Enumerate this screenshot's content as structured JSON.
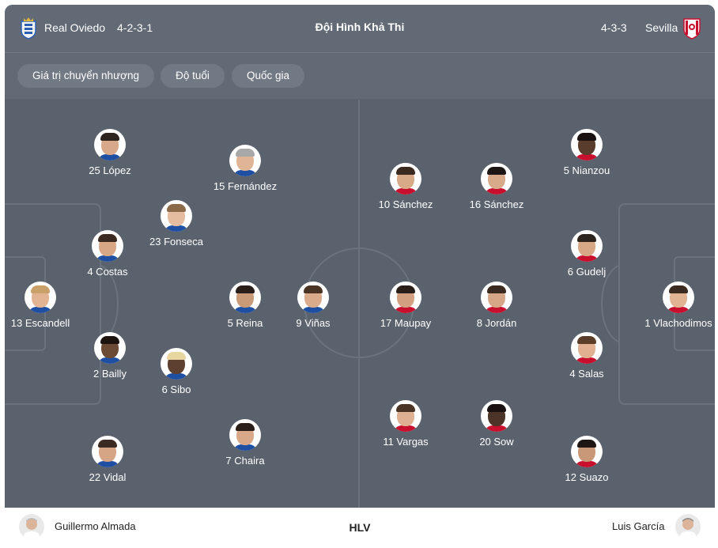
{
  "header": {
    "home_team": "Real Oviedo",
    "home_formation": "4-2-3-1",
    "title": "Đội Hình Khả Thi",
    "away_formation": "4-3-3",
    "away_team": "Sevilla"
  },
  "filters": [
    {
      "label": "Giá trị chuyển nhượng"
    },
    {
      "label": "Độ tuổi"
    },
    {
      "label": "Quốc gia"
    }
  ],
  "home_players": [
    {
      "label": "13 Escandell",
      "skin": "#e3b494",
      "hair": "#c9a06a",
      "kit": "#1f4fa3"
    },
    {
      "label": "4 Costas",
      "skin": "#d8a886",
      "hair": "#3a2a20",
      "kit": "#1f4fa3"
    },
    {
      "label": "2 Bailly",
      "skin": "#6b4a36",
      "hair": "#1d1410",
      "kit": "#1f4fa3"
    },
    {
      "label": "25 López",
      "skin": "#d7a98a",
      "hair": "#2d2420",
      "kit": "#1f4fa3"
    },
    {
      "label": "22 Vidal",
      "skin": "#d6a585",
      "hair": "#3b2b22",
      "kit": "#1f4fa3"
    },
    {
      "label": "23 Fonseca",
      "skin": "#e6bca0",
      "hair": "#8a6a48",
      "kit": "#1f4fa3"
    },
    {
      "label": "6 Sibo",
      "skin": "#5e4030",
      "hair": "#e8d6a0",
      "kit": "#1f4fa3"
    },
    {
      "label": "15 Fernández",
      "skin": "#dfb596",
      "hair": "#a8a8a8",
      "kit": "#1f4fa3"
    },
    {
      "label": "5 Reina",
      "skin": "#c99a78",
      "hair": "#2a1e18",
      "kit": "#1f4fa3"
    },
    {
      "label": "7 Chaira",
      "skin": "#d8a888",
      "hair": "#2a1e18",
      "kit": "#1f4fa3"
    },
    {
      "label": "9 Viñas",
      "skin": "#d9ab8b",
      "hair": "#4a3426",
      "kit": "#1f4fa3"
    }
  ],
  "away_players": [
    {
      "label": "1 Vlachodimos",
      "skin": "#e2b393",
      "hair": "#3a2a20",
      "kit": "#c8102e"
    },
    {
      "label": "6 Gudelj",
      "skin": "#d8a886",
      "hair": "#2e241e",
      "kit": "#c8102e"
    },
    {
      "label": "4 Salas",
      "skin": "#e0b090",
      "hair": "#5a3e2a",
      "kit": "#c8102e"
    },
    {
      "label": "5 Nianzou",
      "skin": "#5a3c2c",
      "hair": "#1a1210",
      "kit": "#c8102e"
    },
    {
      "label": "12 Suazo",
      "skin": "#c89878",
      "hair": "#1e1614",
      "kit": "#c8102e"
    },
    {
      "label": "8 Jordán",
      "skin": "#d6a686",
      "hair": "#3a2a20",
      "kit": "#c8102e"
    },
    {
      "label": "17 Maupay",
      "skin": "#d2a080",
      "hair": "#2a1e18",
      "kit": "#c8102e"
    },
    {
      "label": "16 Sánchez",
      "skin": "#d8aa8a",
      "hair": "#1e1614",
      "kit": "#c8102e"
    },
    {
      "label": "10 Sánchez",
      "skin": "#d9aa88",
      "hair": "#3a2a20",
      "kit": "#c8102e"
    },
    {
      "label": "20 Sow",
      "skin": "#4e3428",
      "hair": "#1a1210",
      "kit": "#c8102e"
    },
    {
      "label": "11 Vargas",
      "skin": "#e0b092",
      "hair": "#4a3426",
      "kit": "#c8102e"
    }
  ],
  "footer": {
    "home_coach": "Guillermo Almada",
    "label": "HLV",
    "away_coach": "Luis García"
  },
  "colors": {
    "card_bg": "#5c6470",
    "pitch_bg": "#5a626e",
    "chip_bg": "#717985"
  }
}
